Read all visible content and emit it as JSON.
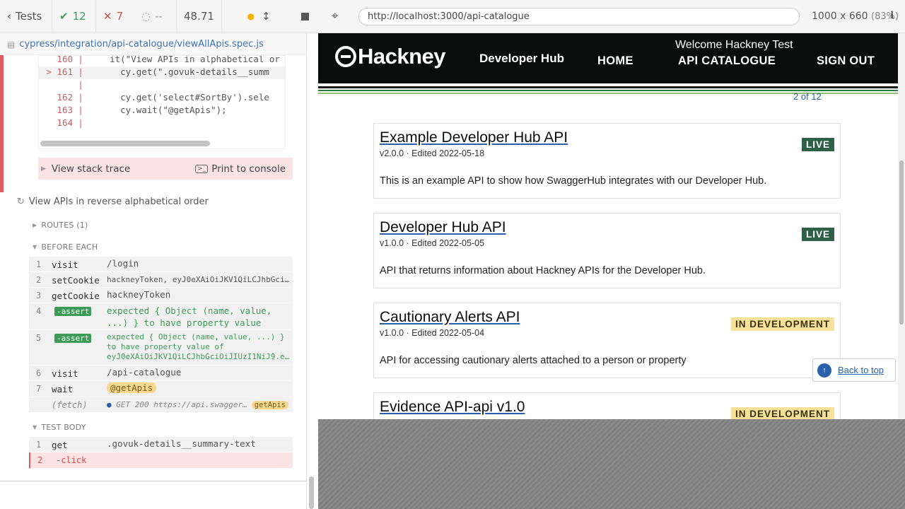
{
  "cypress": {
    "top": {
      "tests_label": "Tests",
      "passed": "12",
      "failed": "7",
      "pending": "--",
      "duration": "48.71"
    },
    "spec_path": "cypress/integration/api-catalogue/viewAllApis.spec.js",
    "code_lines": [
      {
        "num": "160",
        "code": "    it(\"View APIs in alphabetical or"
      },
      {
        "num": "> 161",
        "code": "      cy.get(\".govuk-details__summ"
      },
      {
        "num": "",
        "code": ""
      },
      {
        "num": "162",
        "code": "      cy.get('select#SortBy').sele"
      },
      {
        "num": "163",
        "code": "      cy.wait(\"@getApis\");"
      },
      {
        "num": "164",
        "code": ""
      }
    ],
    "view_stack_trace": "View stack trace",
    "print_to_console": "Print to console",
    "test_title": "View APIs in reverse alphabetical order",
    "routes_label": "ROUTES (1)",
    "before_each_label": "BEFORE EACH",
    "before_each": [
      {
        "num": "1",
        "name": "visit",
        "msg": "/login"
      },
      {
        "num": "2",
        "name": "setCookie",
        "msg": "hackneyToken, eyJ0eXAiOiJKV1QiLCJhbGciOiJ…"
      },
      {
        "num": "3",
        "name": "getCookie",
        "msg": "hackneyToken"
      },
      {
        "num": "4",
        "name": "-assert",
        "msg": "expected { Object (name, value, ...) } to have property value"
      },
      {
        "num": "5",
        "name": "-assert",
        "msg": "expected { Object (name, value, ...) } to have property value of eyJ0eXAiOiJKV1QiLCJhbGciOiJIUzI1NiJ9.eyJ…"
      },
      {
        "num": "6",
        "name": "visit",
        "msg": "/api-catalogue"
      },
      {
        "num": "7",
        "name": "wait",
        "msg": "@getApis"
      },
      {
        "num": "",
        "name": "(fetch)",
        "msg": "GET 200 https://api.swaggerhu…",
        "alias": "getApis"
      }
    ],
    "test_body_label": "TEST BODY",
    "test_body": [
      {
        "num": "1",
        "name": "get",
        "msg": ".govuk-details__summary-text"
      },
      {
        "num": "2",
        "name": "-click",
        "msg": ""
      }
    ]
  },
  "browser": {
    "url": "http://localhost:3000/api-catalogue",
    "viewport": "1000 x 660",
    "zoom": "(83%)"
  },
  "site": {
    "logo": "Hackney",
    "product": "Developer Hub",
    "welcome": "Welcome Hackney Test",
    "nav": [
      "HOME",
      "API CATALOGUE",
      "SIGN OUT"
    ],
    "page_count": "2 of 12",
    "cards": [
      {
        "title": "Example Developer Hub API",
        "meta": "v2.0.0 · Edited 2022-05-18",
        "description": "This is an example API to show how SwaggerHub integrates with our Developer Hub.",
        "status": "LIVE"
      },
      {
        "title": "Developer Hub API",
        "meta": "v1.0.0 · Edited 2022-05-05",
        "description": "API that returns information about Hackney APIs for the Developer Hub.",
        "status": "LIVE"
      },
      {
        "title": "Cautionary Alerts API",
        "meta": "v1.0.0 · Edited 2022-05-04",
        "description": "API for accessing cautionary alerts attached to a person or property",
        "status": "IN DEVELOPMENT"
      },
      {
        "title": "Evidence API-api v1.0",
        "meta": "",
        "description": "",
        "status": "IN DEVELOPMENT"
      }
    ],
    "back_to_top": "Back to top"
  },
  "colors": {
    "pass": "#3c9c57",
    "fail": "#d64b4b",
    "live_tag": "#2d6047",
    "dev_tag": "#f5e199",
    "header_bg": "#0b0c0c",
    "link": "#2a5faa"
  }
}
